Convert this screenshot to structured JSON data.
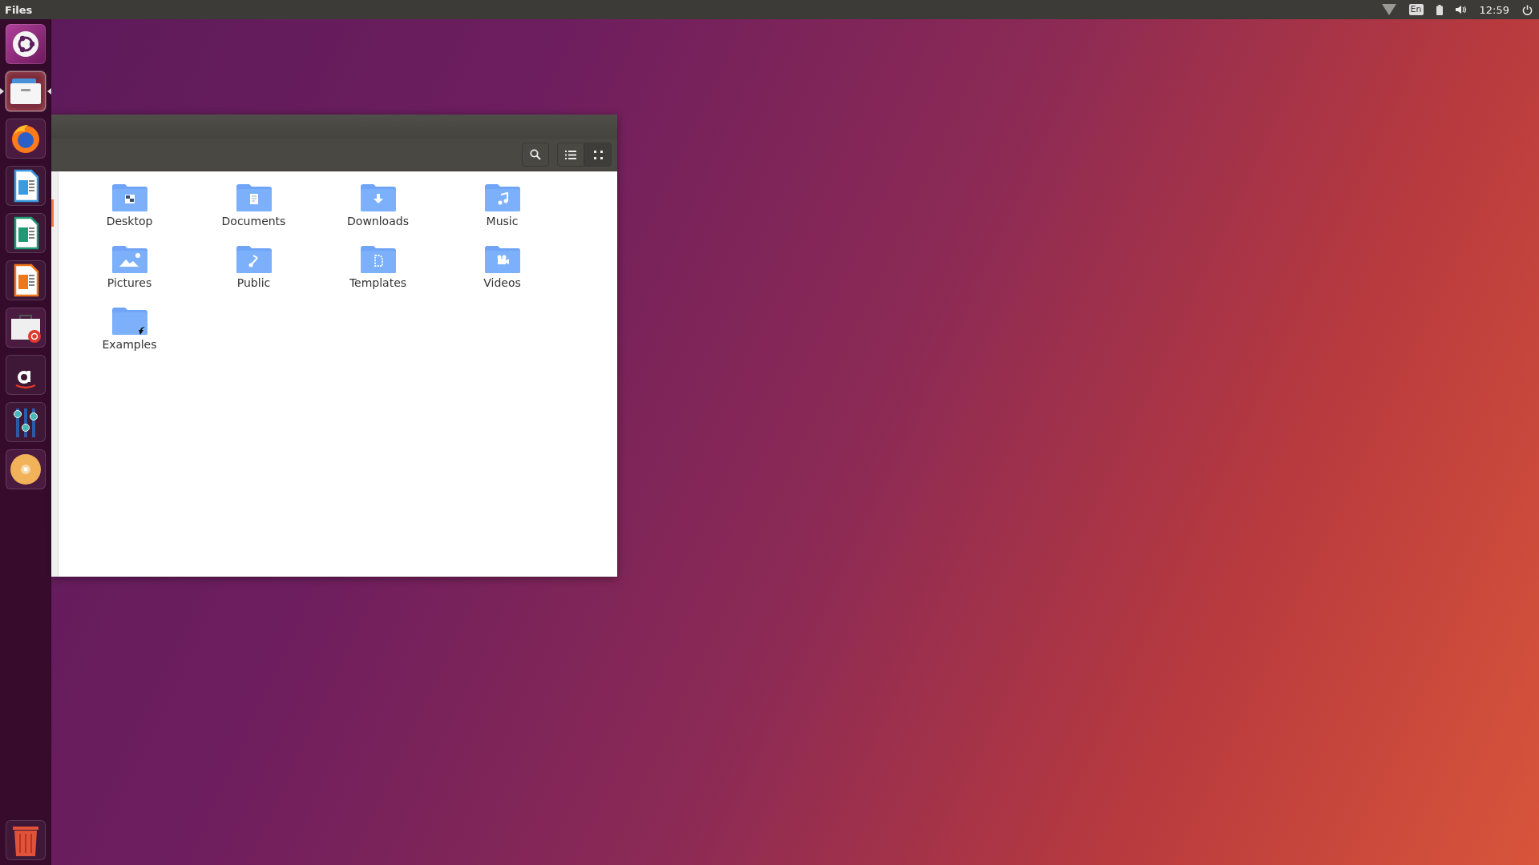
{
  "top_bar": {
    "app_menu": "Files",
    "keyboard_layout": "En",
    "clock": "12:59"
  },
  "launcher": {
    "items": [
      {
        "kind": "ubuntu",
        "running": false,
        "focused": false
      },
      {
        "kind": "files",
        "running": true,
        "focused": true
      },
      {
        "kind": "firefox",
        "running": false,
        "focused": false
      },
      {
        "kind": "writer",
        "running": false,
        "focused": false
      },
      {
        "kind": "calc",
        "running": false,
        "focused": false
      },
      {
        "kind": "impress",
        "running": false,
        "focused": false
      },
      {
        "kind": "software",
        "running": false,
        "focused": false
      },
      {
        "kind": "amazon",
        "running": false,
        "focused": false
      },
      {
        "kind": "settings",
        "running": false,
        "focused": false
      },
      {
        "kind": "disc",
        "running": false,
        "focused": false
      }
    ],
    "trash": {
      "kind": "trash"
    }
  },
  "window": {
    "view_buttons": [
      {
        "kind": "list",
        "selected": false
      },
      {
        "kind": "grid",
        "selected": true
      }
    ],
    "folders": [
      {
        "name": "Desktop",
        "kind": "desktop",
        "link": false
      },
      {
        "name": "Documents",
        "kind": "documents",
        "link": false
      },
      {
        "name": "Downloads",
        "kind": "downloads",
        "link": false
      },
      {
        "name": "Music",
        "kind": "music",
        "link": false
      },
      {
        "name": "Pictures",
        "kind": "pictures",
        "link": false
      },
      {
        "name": "Public",
        "kind": "public",
        "link": false
      },
      {
        "name": "Templates",
        "kind": "templates",
        "link": false
      },
      {
        "name": "Videos",
        "kind": "videos",
        "link": false
      },
      {
        "name": "Examples",
        "kind": "plain",
        "link": true
      }
    ]
  }
}
